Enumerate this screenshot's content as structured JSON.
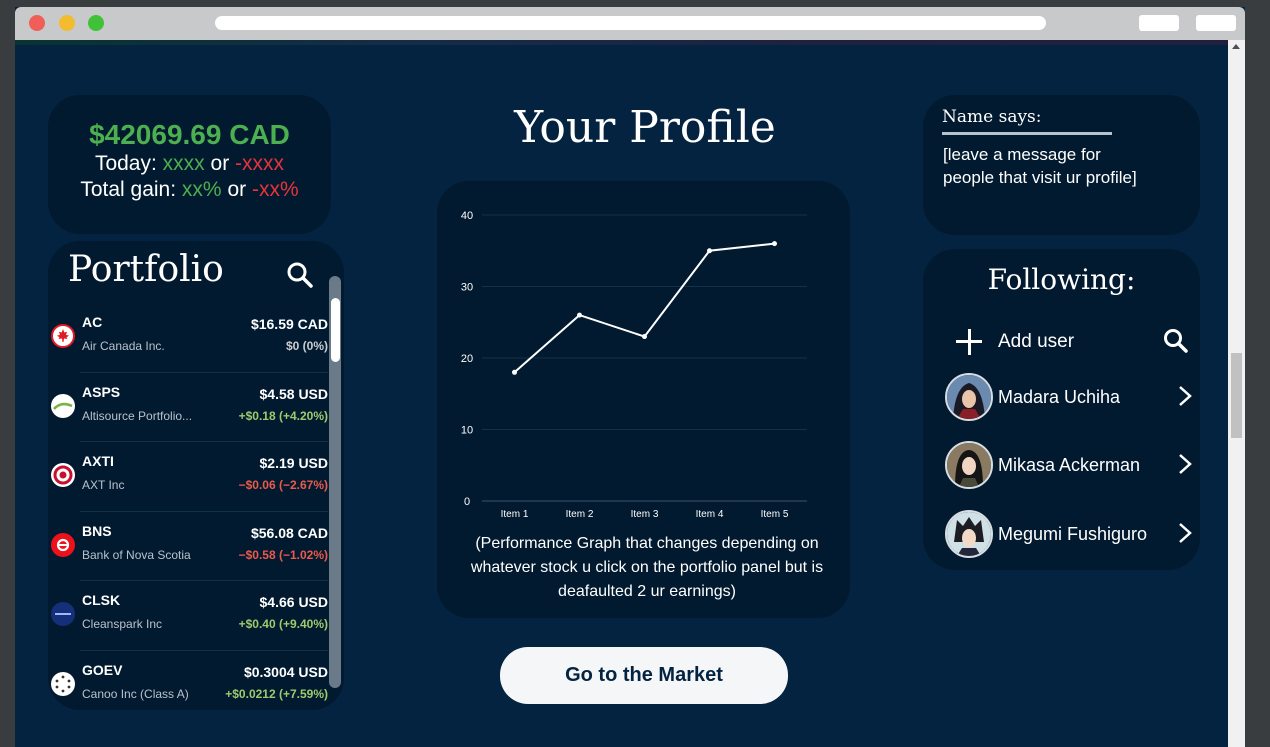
{
  "balance": {
    "amount": "$42069.69 CAD",
    "today_label": "Today:",
    "today_gain": "xxxx",
    "or": "or",
    "today_loss": "-xxxx",
    "total_label": "Total gain:",
    "total_gain": "xx%",
    "total_loss": "-xx%"
  },
  "portfolio": {
    "title": "Portfolio",
    "stocks": [
      {
        "ticker": "AC",
        "name": "Air Canada Inc.",
        "price": "$16.59 CAD",
        "change": "$0 (0%)",
        "trend": "neutral",
        "logo": "maple-leaf-icon"
      },
      {
        "ticker": "ASPS",
        "name": "Altisource Portfolio...",
        "price": "$4.58 USD",
        "change": "+$0.18 (+4.20%)",
        "trend": "up",
        "logo": "swoosh-icon"
      },
      {
        "ticker": "AXTI",
        "name": "AXT Inc",
        "price": "$2.19 USD",
        "change": "−$0.06 (−2.67%)",
        "trend": "down",
        "logo": "ring-icon"
      },
      {
        "ticker": "BNS",
        "name": "Bank of Nova Scotia",
        "price": "$56.08 CAD",
        "change": "−$0.58 (−1.02%)",
        "trend": "down",
        "logo": "scotia-s-icon"
      },
      {
        "ticker": "CLSK",
        "name": "Cleanspark Inc",
        "price": "$4.66 USD",
        "change": "+$0.40 (+9.40%)",
        "trend": "up",
        "logo": "cleanspark-icon"
      },
      {
        "ticker": "GOEV",
        "name": "Canoo Inc (Class A)",
        "price": "$0.3004 USD",
        "change": "+$0.0212 (+7.59%)",
        "trend": "up",
        "logo": "dots-icon"
      }
    ]
  },
  "profile": {
    "title": "Your Profile",
    "caption": "(Performance Graph that changes depending on whatever stock u click on the portfolio panel but is deafaulted 2 ur earnings)",
    "market_button": "Go to the Market"
  },
  "chart_data": {
    "type": "line",
    "categories": [
      "Item 1",
      "Item 2",
      "Item 3",
      "Item 4",
      "Item 5"
    ],
    "values": [
      18,
      26,
      23,
      35,
      36
    ],
    "ylim": [
      0,
      40
    ],
    "yticks": [
      "0",
      "10",
      "20",
      "30",
      "40"
    ],
    "grid": true,
    "title": "",
    "xlabel": "",
    "ylabel": ""
  },
  "message": {
    "heading": "Name says:",
    "body": "[leave a message for people that visit ur profile]"
  },
  "following": {
    "title": "Following:",
    "add_label": "Add user",
    "users": [
      {
        "name": "Madara Uchiha"
      },
      {
        "name": "Mikasa Ackerman"
      },
      {
        "name": "Megumi Fushiguro"
      }
    ]
  },
  "colors": {
    "background": "#032340",
    "panel": "#021a2f",
    "gain": "#4caf50",
    "loss": "#e8333a"
  }
}
